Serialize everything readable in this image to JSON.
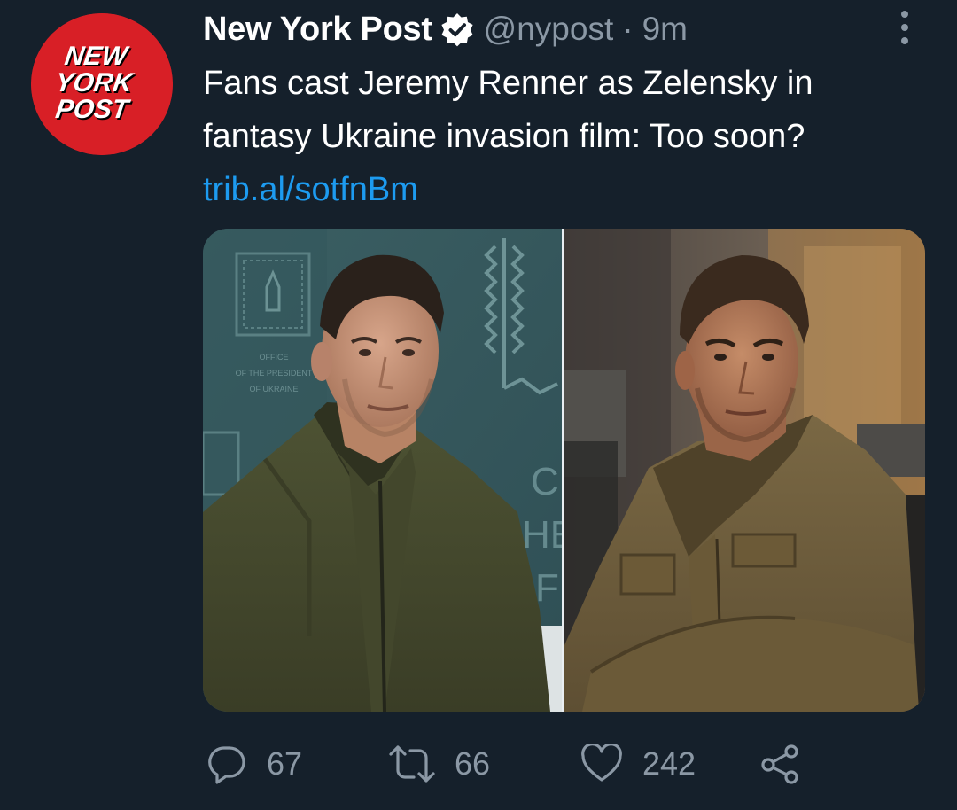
{
  "author": {
    "display_name": "New York Post",
    "handle": "@nypost",
    "separator": "·",
    "time": "9m",
    "verified": true,
    "avatar_text": [
      "NEW",
      "YORK",
      "POST"
    ],
    "avatar_color": "#d81f26"
  },
  "tweet": {
    "text_line1": "Fans cast Jeremy Renner as Zelensky in",
    "text_line2": "fantasy Ukraine invasion film: Too soon?",
    "link": "trib.al/sotfnBm"
  },
  "media": {
    "left_image": "zelensky-photo",
    "right_image": "renner-photo",
    "left_wall_text": [
      "OFFICE",
      "OF THE PRESIDENT",
      "OF UKRAINE"
    ],
    "left_wall_letters": [
      "C",
      "HE",
      "F"
    ]
  },
  "actions": {
    "reply_count": "67",
    "retweet_count": "66",
    "like_count": "242",
    "icons": [
      "reply-icon",
      "retweet-icon",
      "like-icon",
      "share-icon"
    ]
  },
  "colors": {
    "background": "#15202b",
    "secondary_text": "#8b98a5",
    "link": "#1d9bf0",
    "verified_badge": "#ffffff"
  }
}
